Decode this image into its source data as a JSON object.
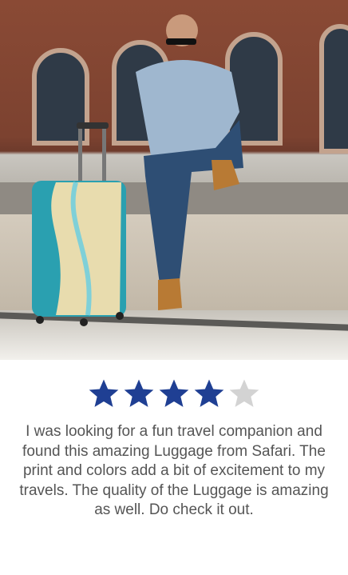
{
  "photo": {
    "description_icon": "photo-man-with-suitcase"
  },
  "rating": {
    "value": 4,
    "max": 5,
    "filled_color": "#1f3f93",
    "empty_color": "#d3d3d3"
  },
  "review": {
    "text": "I was looking for a fun travel companion and found this amazing Luggage from Safari. The print and colors add a bit of excitement to my travels. The quality of the Luggage is amazing as well. Do check it out."
  }
}
